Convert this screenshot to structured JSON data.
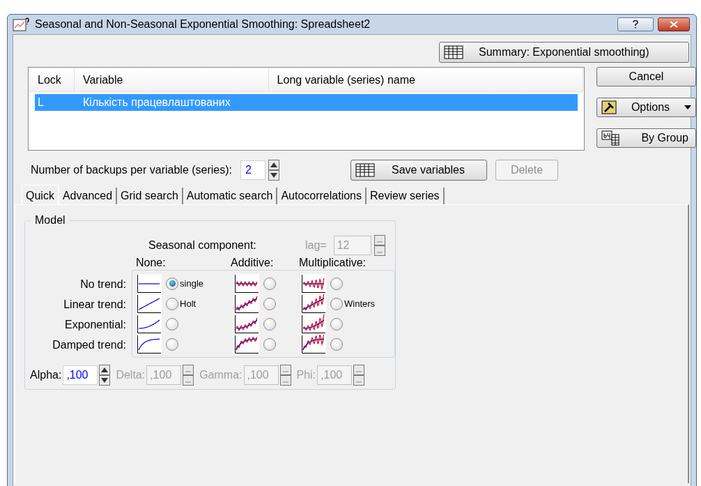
{
  "window": {
    "title": "Seasonal and Non-Seasonal Exponential Smoothing: Spreadsheet2"
  },
  "summary_button": "Summary:  Exponential smoothing)",
  "side_buttons": [
    {
      "kind": "plain",
      "label": "Cancel"
    },
    {
      "kind": "options",
      "label": "Options"
    },
    {
      "kind": "bygroup",
      "label": "By Group"
    }
  ],
  "table": {
    "columns": [
      "Lock",
      "Variable",
      "Long variable (series) name"
    ],
    "rows": [
      {
        "lock": "L",
        "variable": "Кількість працевлаштованих",
        "selected": true
      }
    ]
  },
  "backups": {
    "label": "Number of backups per variable (series):",
    "value": "2"
  },
  "save_button": "Save variables",
  "delete_button": {
    "label": "Delete",
    "disabled": true
  },
  "tabs": [
    {
      "label": "Quick",
      "selected": true
    },
    {
      "label": "Advanced",
      "selected": false
    },
    {
      "label": "Grid search",
      "selected": false
    },
    {
      "label": "Automatic search",
      "selected": false
    },
    {
      "label": "Autocorrelations",
      "selected": false
    },
    {
      "label": "Review series",
      "selected": false
    }
  ],
  "model": {
    "title": "Model",
    "seasonal_label": "Seasonal component:",
    "lag": {
      "label": "lag=",
      "value": "12",
      "disabled": true
    },
    "columns": [
      {
        "kind": "none",
        "label": "None:"
      },
      {
        "kind": "additive",
        "label": "Additive:"
      },
      {
        "kind": "multiplicative",
        "label": "Multiplicative:"
      }
    ],
    "rows": [
      {
        "kind": "flat",
        "label": "No trend:",
        "options": [
          {
            "selected": true,
            "label": "single"
          },
          {
            "selected": false
          },
          {
            "selected": false
          }
        ]
      },
      {
        "kind": "linear",
        "label": "Linear trend:",
        "options": [
          {
            "selected": false,
            "label": "Holt"
          },
          {
            "selected": false
          },
          {
            "selected": false,
            "label": "Winters"
          }
        ]
      },
      {
        "kind": "exponential",
        "label": "Exponential:",
        "options": [
          {
            "selected": false
          },
          {
            "selected": false
          },
          {
            "selected": false
          }
        ]
      },
      {
        "kind": "damped",
        "label": "Damped trend:",
        "options": [
          {
            "selected": false
          },
          {
            "selected": false
          },
          {
            "selected": false
          }
        ]
      }
    ],
    "params": [
      {
        "label": "Alpha:",
        "value": ",100",
        "disabled": false
      },
      {
        "label": "Delta:",
        "value": ",100",
        "disabled": true
      },
      {
        "label": "Gamma:",
        "value": ",100",
        "disabled": true
      },
      {
        "label": "Phi:",
        "value": ",100",
        "disabled": true
      }
    ]
  }
}
